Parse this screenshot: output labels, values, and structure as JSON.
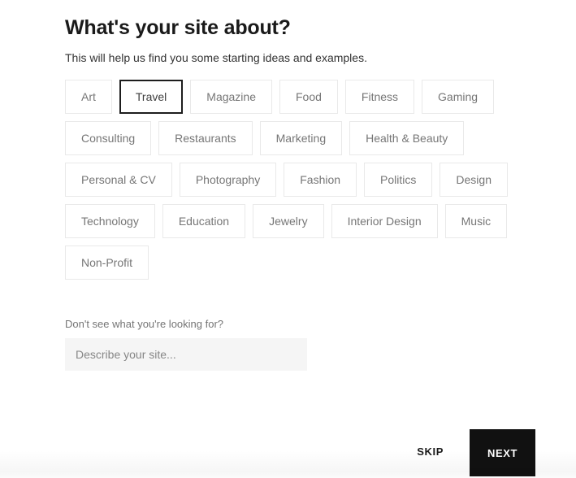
{
  "header": {
    "title": "What's your site about?",
    "subtitle": "This will help us find you some starting ideas and examples."
  },
  "categories": {
    "selected": "Travel",
    "rows": [
      [
        {
          "label": "Art",
          "selected": false
        },
        {
          "label": "Travel",
          "selected": true
        },
        {
          "label": "Magazine",
          "selected": false
        },
        {
          "label": "Food",
          "selected": false
        },
        {
          "label": "Fitness",
          "selected": false
        },
        {
          "label": "Gaming",
          "selected": false
        }
      ],
      [
        {
          "label": "Consulting",
          "selected": false
        },
        {
          "label": "Restaurants",
          "selected": false
        },
        {
          "label": "Marketing",
          "selected": false
        },
        {
          "label": "Health & Beauty",
          "selected": false
        }
      ],
      [
        {
          "label": "Personal & CV",
          "selected": false
        },
        {
          "label": "Photography",
          "selected": false
        },
        {
          "label": "Fashion",
          "selected": false
        },
        {
          "label": "Politics",
          "selected": false
        },
        {
          "label": "Design",
          "selected": false
        }
      ],
      [
        {
          "label": "Technology",
          "selected": false
        },
        {
          "label": "Education",
          "selected": false
        },
        {
          "label": "Jewelry",
          "selected": false
        },
        {
          "label": "Interior Design",
          "selected": false
        },
        {
          "label": "Music",
          "selected": false
        }
      ],
      [
        {
          "label": "Non-Profit",
          "selected": false
        }
      ]
    ]
  },
  "describe": {
    "label": "Don't see what you're looking for?",
    "placeholder": "Describe your site...",
    "value": ""
  },
  "footer": {
    "skip_label": "SKIP",
    "next_label": "NEXT"
  },
  "colors": {
    "accent": "#111111",
    "selected_border": "#1d1d1d",
    "chip_border": "#e9e9e9",
    "chip_text": "#767676",
    "input_background": "#f5f5f5"
  }
}
